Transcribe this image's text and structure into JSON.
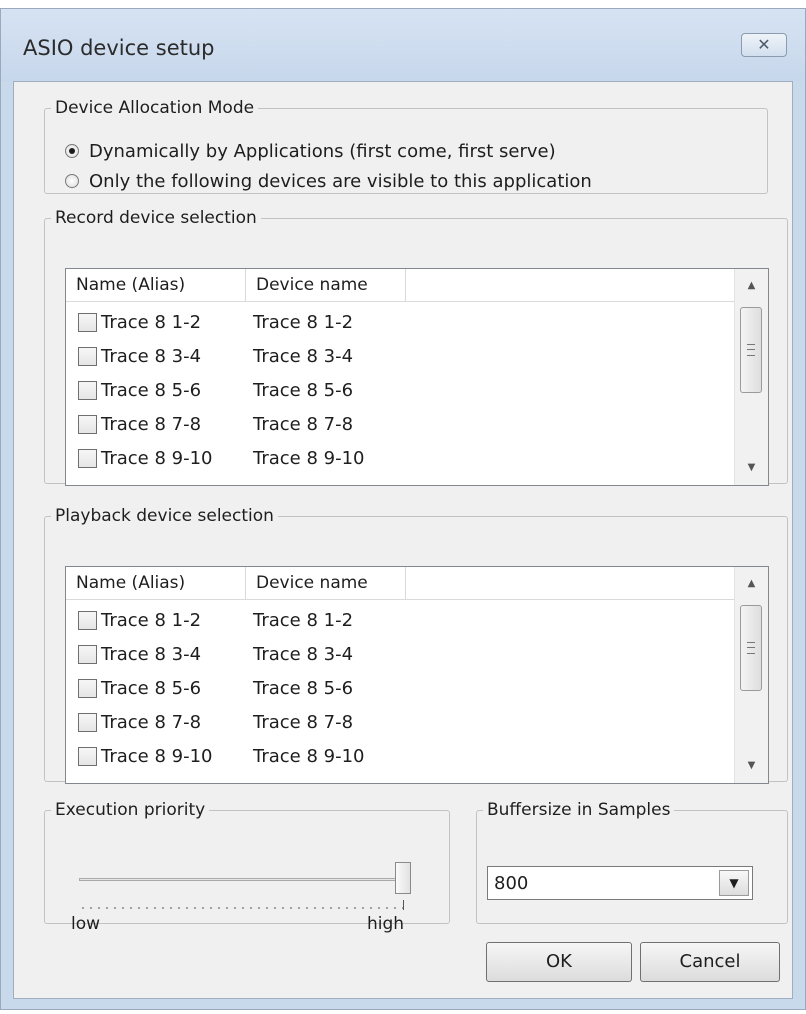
{
  "window": {
    "title": "ASIO device setup",
    "close_glyph": "✕"
  },
  "allocation": {
    "legend": "Device Allocation Mode",
    "options": [
      {
        "label": "Dynamically by Applications (first come, first serve)",
        "checked": true
      },
      {
        "label": "Only the following devices are visible to this application",
        "checked": false
      }
    ]
  },
  "record": {
    "legend": "Record device selection",
    "columns": [
      "Name (Alias)",
      "Device name"
    ],
    "rows": [
      {
        "alias": "Trace 8 1-2",
        "device": "Trace 8 1-2",
        "checked": false
      },
      {
        "alias": "Trace 8 3-4",
        "device": "Trace 8 3-4",
        "checked": false
      },
      {
        "alias": "Trace 8 5-6",
        "device": "Trace 8 5-6",
        "checked": false
      },
      {
        "alias": "Trace 8 7-8",
        "device": "Trace 8 7-8",
        "checked": false
      },
      {
        "alias": "Trace 8 9-10",
        "device": "Trace 8 9-10",
        "checked": false
      }
    ]
  },
  "playback": {
    "legend": "Playback device selection",
    "columns": [
      "Name (Alias)",
      "Device name"
    ],
    "rows": [
      {
        "alias": "Trace 8 1-2",
        "device": "Trace 8 1-2",
        "checked": false
      },
      {
        "alias": "Trace 8 3-4",
        "device": "Trace 8 3-4",
        "checked": false
      },
      {
        "alias": "Trace 8 5-6",
        "device": "Trace 8 5-6",
        "checked": false
      },
      {
        "alias": "Trace 8 7-8",
        "device": "Trace 8 7-8",
        "checked": false
      },
      {
        "alias": "Trace 8 9-10",
        "device": "Trace 8 9-10",
        "checked": false
      }
    ]
  },
  "priority": {
    "legend": "Execution priority",
    "low_label": "low",
    "high_label": "high",
    "level": 1.0
  },
  "buffer": {
    "legend": "Buffersize in Samples",
    "value": "800"
  },
  "buttons": {
    "ok": "OK",
    "cancel": "Cancel"
  },
  "icons": {
    "scroll_up": "up-arrow-icon",
    "scroll_down": "down-arrow-icon",
    "dropdown": "chevron-down-icon",
    "close": "close-icon"
  }
}
